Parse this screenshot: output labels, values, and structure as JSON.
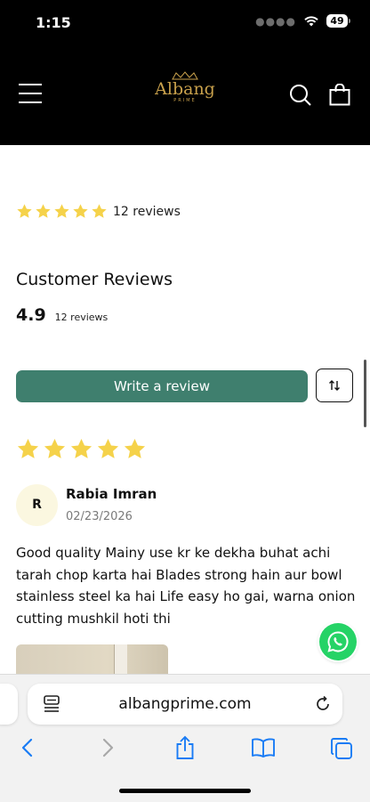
{
  "status_bar": {
    "time": "1:15",
    "battery": "49"
  },
  "header": {
    "logo_text": "Albang",
    "logo_subtext": "PRIME",
    "brand_gold": "#c9a14c",
    "icons": [
      "menu-icon",
      "search-icon",
      "cart-icon"
    ]
  },
  "summary": {
    "rating_count_label": "12 reviews",
    "stars": 5,
    "star_color": "#f5d24a"
  },
  "reviews_section": {
    "title": "Customer Reviews",
    "average": "4.9",
    "count_label": "12 reviews",
    "write_review_label": "Write a review",
    "sort_icon": "sort-icon",
    "accent": "#3f7f6e"
  },
  "review": {
    "stars": 5,
    "avatar_initial": "R",
    "author": "Rabia Imran",
    "date": "02/23/2026",
    "body": "Good quality Mainy use kr ke dekha buhat achi tarah chop karta hai Blades strong hain aur bowl stainless steel ka hai Life easy ho gai, warna onion cutting mushkil hoti thi"
  },
  "floating": {
    "icon": "whatsapp-icon",
    "color": "#25d366"
  },
  "browser": {
    "url": "albangprime.com",
    "toolbar_icons": [
      "back-icon",
      "forward-icon",
      "share-icon",
      "bookmarks-icon",
      "tabs-icon"
    ],
    "accent": "#1a7cf5"
  }
}
